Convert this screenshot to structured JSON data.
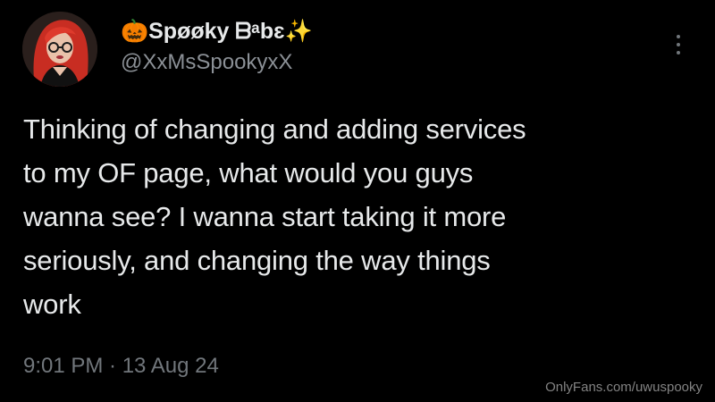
{
  "author": {
    "display_name": "🎃Spøøky ᗷᵃbɛ✨",
    "handle": "@XxMsSpookyxX",
    "avatar_icon": "profile-photo"
  },
  "tweet": {
    "lines": [
      "Thinking of changing and adding services",
      "to my OF page, what would you guys",
      "wanna see? I wanna start taking it more",
      "seriously, and changing the way things",
      "work"
    ],
    "timestamp": "9:01 PM · 13 Aug 24"
  },
  "more_menu_icon": "vertical-ellipsis-icon",
  "watermark": "OnlyFans.com/uwuspooky",
  "colors": {
    "background": "#000000",
    "primary_text": "#e7e9ea",
    "secondary_text": "#71767b",
    "hair": "#d9362b"
  }
}
